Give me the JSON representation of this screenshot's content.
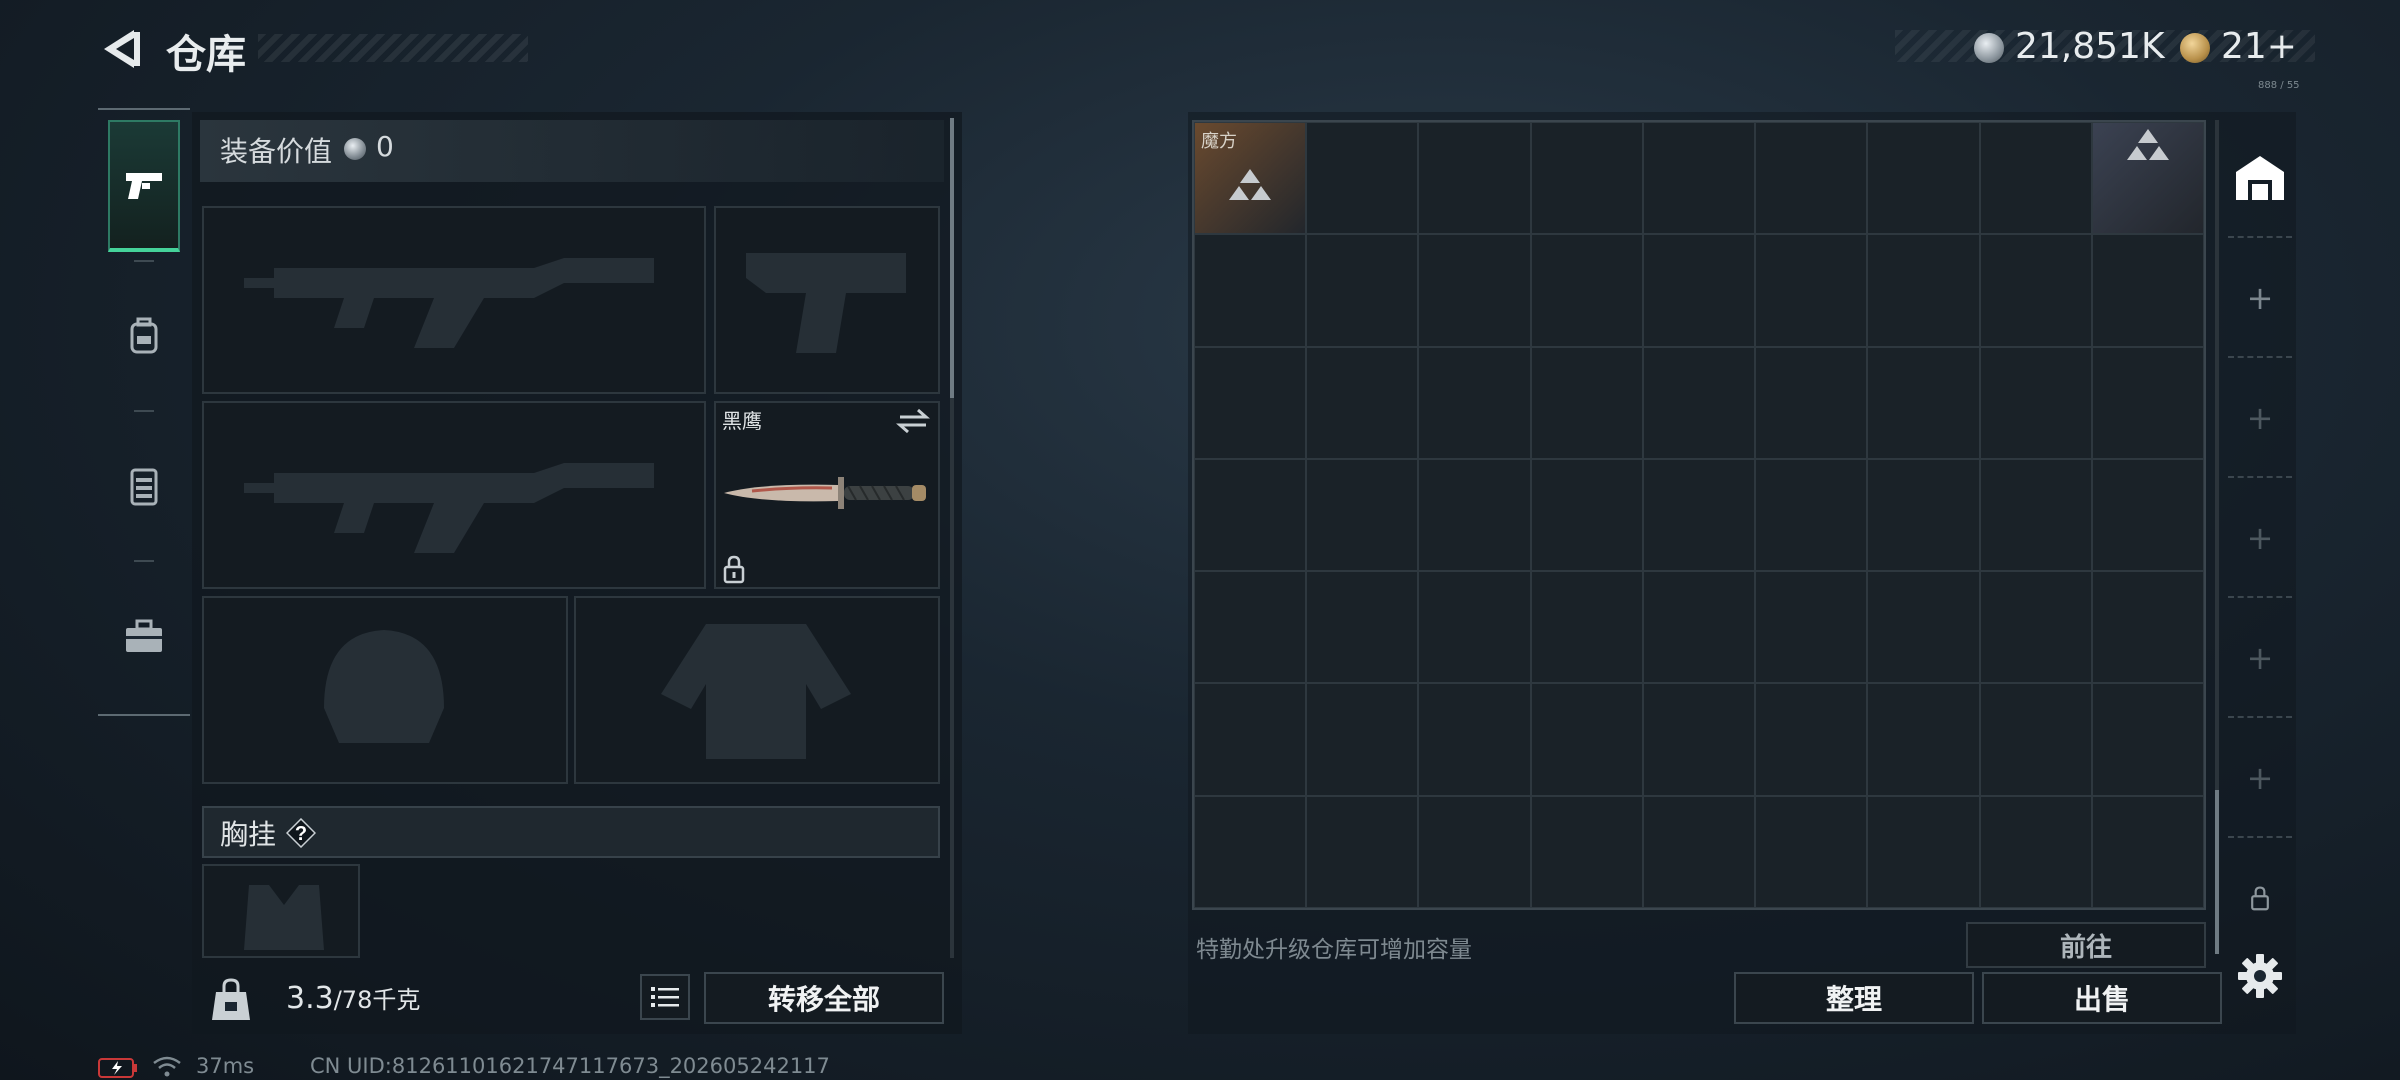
{
  "header": {
    "title": "仓库",
    "currency_amount": "21,851K",
    "token_amount": "21+",
    "tiny_label": "888 / 55"
  },
  "icons": {
    "back": "back-arrow-icon",
    "currency": "silver-coin-icon",
    "token": "gold-triangle-token-icon",
    "tabs": [
      "pistol-icon",
      "backpack-icon",
      "chest-rig-icon",
      "toolbox-icon"
    ],
    "right_tabs": [
      "warehouse-icon",
      "plus-icon",
      "plus-icon",
      "plus-icon",
      "plus-icon",
      "plus-icon",
      "lock-icon"
    ],
    "settings": "gear-icon"
  },
  "equipment": {
    "value_label": "装备价值",
    "value_amount": "0",
    "melee_name": "黑鹰",
    "chest_rig_label": "胸挂",
    "chest_rig_help": "?",
    "weight_current": "3.3",
    "weight_max": "/78千克",
    "transfer_all": "转移全部"
  },
  "storage": {
    "columns": 9,
    "rows": 7,
    "items": [
      {
        "name": "魔方",
        "row": 0,
        "col": 0,
        "color": "#6a4a2e"
      },
      {
        "name": "",
        "row": 0,
        "col": 8,
        "color": "#3b4252"
      }
    ],
    "upgrade_hint": "特勤处升级仓库可增加容量",
    "goto": "前往",
    "sort": "整理",
    "sell": "出售"
  },
  "status": {
    "ping": "37ms",
    "uid": "CN UID:812611016217471176​73_202605242117"
  },
  "colors": {
    "accent": "#45d39a",
    "background": "#1a2631",
    "rubik_item": "#6a4a2e"
  }
}
